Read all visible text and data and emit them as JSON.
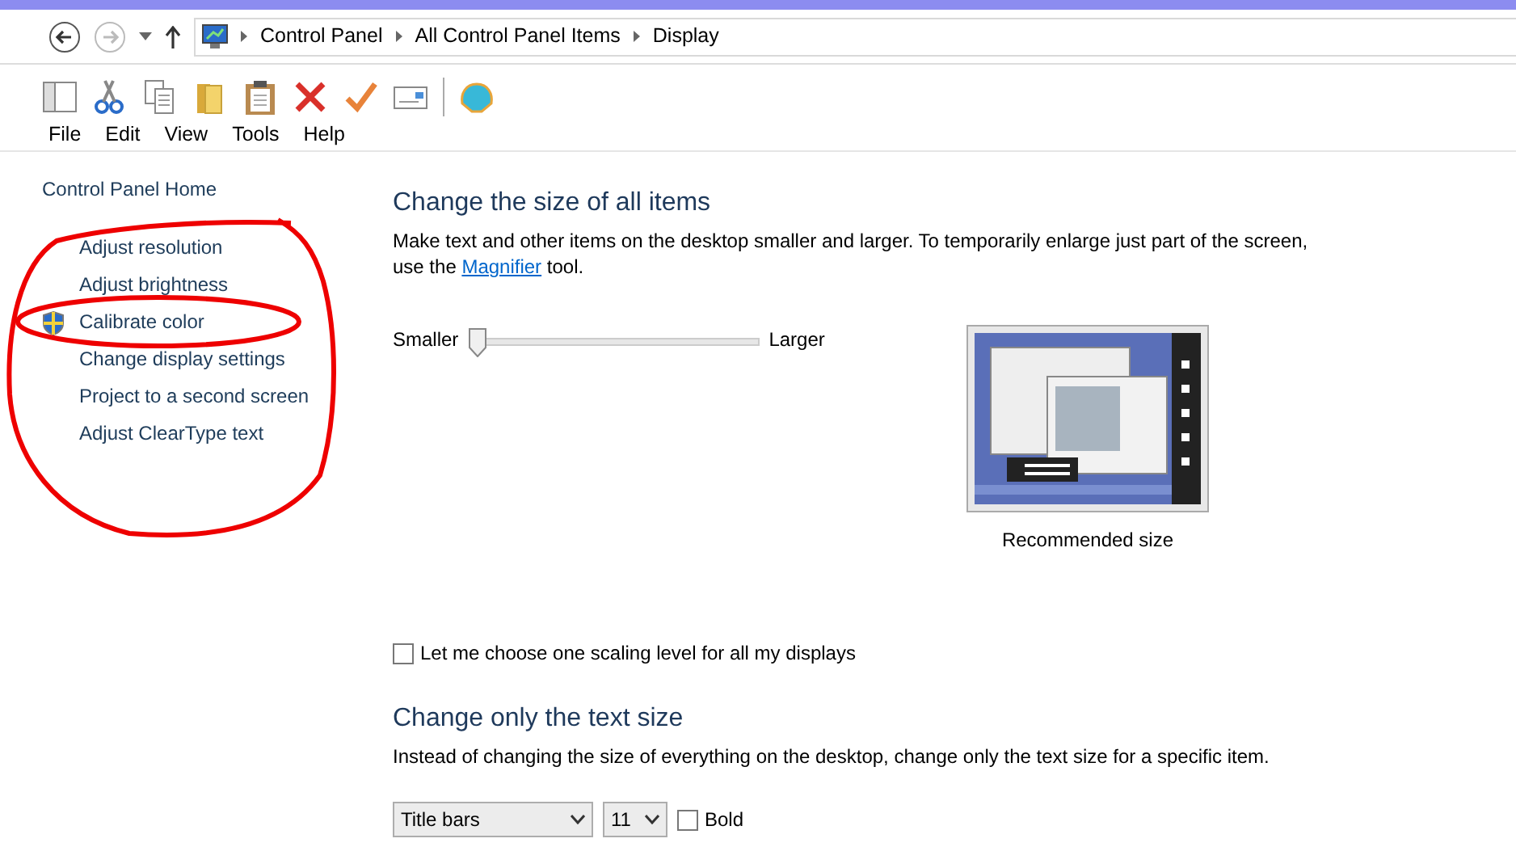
{
  "breadcrumb": [
    "Control Panel",
    "All Control Panel Items",
    "Display"
  ],
  "menu": [
    "File",
    "Edit",
    "View",
    "Tools",
    "Help"
  ],
  "sidebar": {
    "items": [
      {
        "label": "Control Panel Home",
        "shield": false
      },
      {
        "label": "Adjust resolution",
        "shield": false
      },
      {
        "label": "Adjust brightness",
        "shield": false
      },
      {
        "label": "Calibrate color",
        "shield": true
      },
      {
        "label": "Change display settings",
        "shield": false
      },
      {
        "label": "Project to a second screen",
        "shield": false
      },
      {
        "label": "Adjust ClearType text",
        "shield": false
      }
    ]
  },
  "size_section": {
    "heading": "Change the size of all items",
    "description_start": "Make text and other items on the desktop smaller and larger. To temporarily enlarge just part of the screen, use the ",
    "link": "Magnifier",
    "description_end": " tool.",
    "slider": {
      "min_label": "Smaller",
      "max_label": "Larger",
      "level": 0
    },
    "preview_caption": "Recommended size"
  },
  "scaling_checkbox": {
    "label": "Let me choose one scaling level for all my displays",
    "checked": false
  },
  "text_section": {
    "heading": "Change only the text size",
    "description": "Instead of changing the size of everything on the desktop, change only the text size for a specific item.",
    "item_select": "Title bars",
    "size_select": "11",
    "bold": {
      "label": "Bold",
      "checked": false
    }
  }
}
